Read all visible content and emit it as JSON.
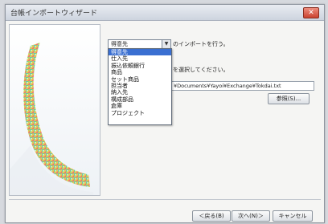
{
  "window": {
    "title": "台帳インポートウィザード",
    "close_icon": "close-icon",
    "close_glyph": "✕"
  },
  "side_panel": {
    "icon": "document-ribbon-illustration"
  },
  "combo": {
    "value": "得意先",
    "arrow_glyph": "▼",
    "suffix": "のインポートを行う。"
  },
  "dropdown": {
    "options": [
      "得意先",
      "仕入先",
      "振込依頼銀行",
      "商品",
      "セット商品",
      "担当者",
      "納入先",
      "構成部品",
      "倉庫",
      "プロジェクト"
    ],
    "selected_index": 0
  },
  "instruction": "を選択してください。",
  "path": "¥Documents¥Yayoi¥Exchange¥Tokdai.txt",
  "buttons": {
    "browse": "参照(S)...",
    "back": "＜戻る(B)",
    "next": "次へ(N)＞",
    "cancel": "キャンセル"
  },
  "colors": {
    "selection": "#3a6fd1",
    "close_button": "#c9432f"
  }
}
